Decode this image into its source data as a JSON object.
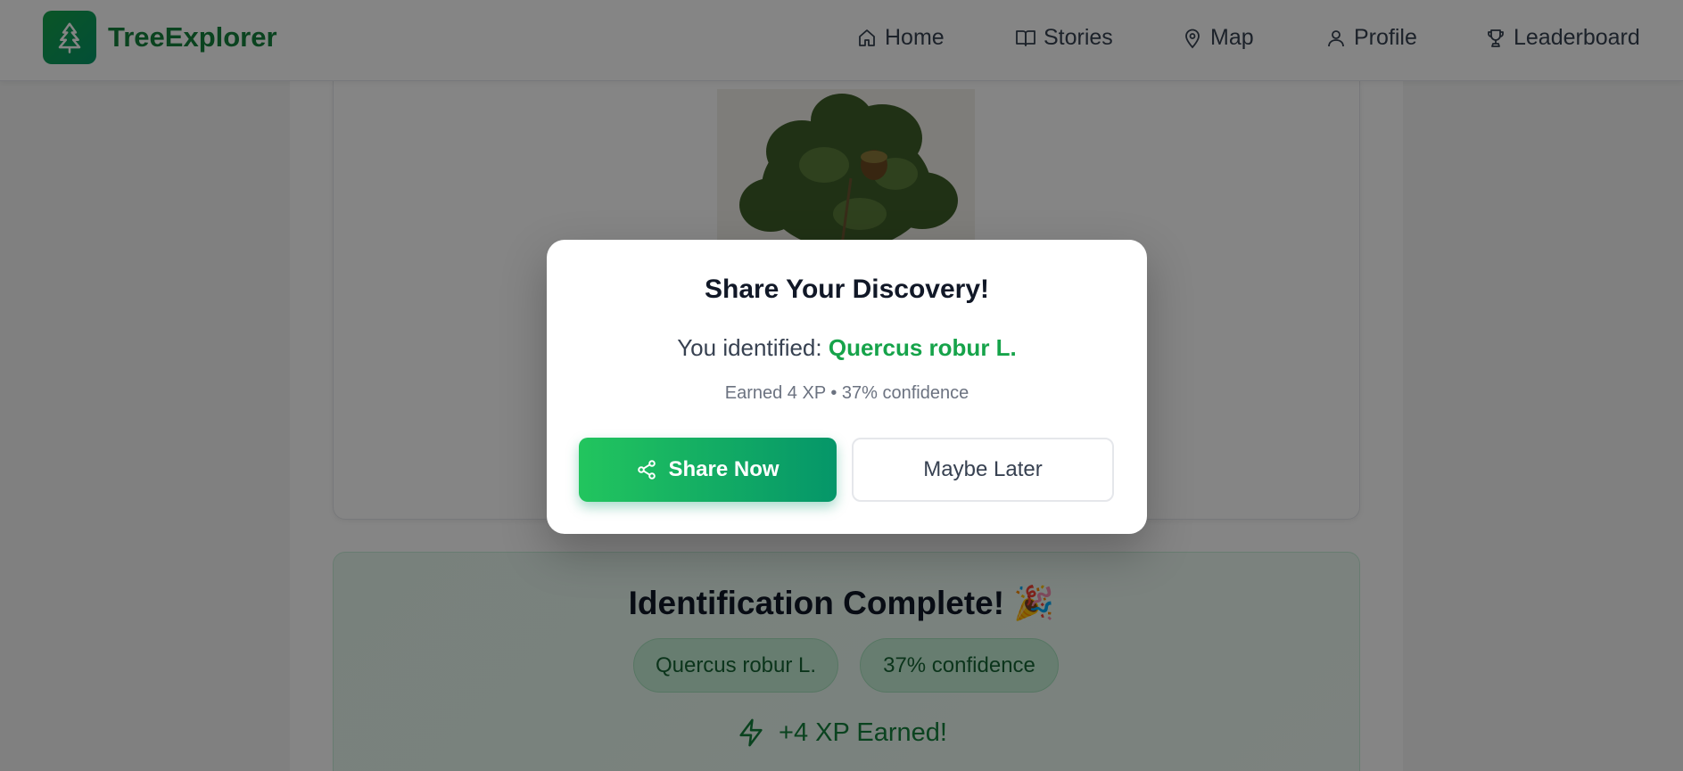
{
  "app": {
    "name": "TreeExplorer",
    "logo_icon": "tree-icon"
  },
  "nav": {
    "items": [
      {
        "label": "Home",
        "icon": "home-icon"
      },
      {
        "label": "Stories",
        "icon": "book-icon"
      },
      {
        "label": "Map",
        "icon": "map-pin-icon"
      },
      {
        "label": "Profile",
        "icon": "user-icon"
      },
      {
        "label": "Leaderboard",
        "icon": "trophy-icon"
      }
    ]
  },
  "result": {
    "title": "Identification Complete! 🎉",
    "species_pill": "Quercus robur L.",
    "confidence_pill": "37% confidence",
    "xp_text": "+4 XP Earned!"
  },
  "modal": {
    "title": "Share Your Discovery!",
    "identified_prefix": "You identified: ",
    "species": "Quercus robur L.",
    "meta": "Earned 4 XP • 37% confidence",
    "share_button": "Share Now",
    "later_button": "Maybe Later"
  },
  "colors": {
    "brand": "#15803d",
    "accent_green": "#16a34a",
    "button_gradient_start": "#22c55e",
    "button_gradient_end": "#059669"
  }
}
